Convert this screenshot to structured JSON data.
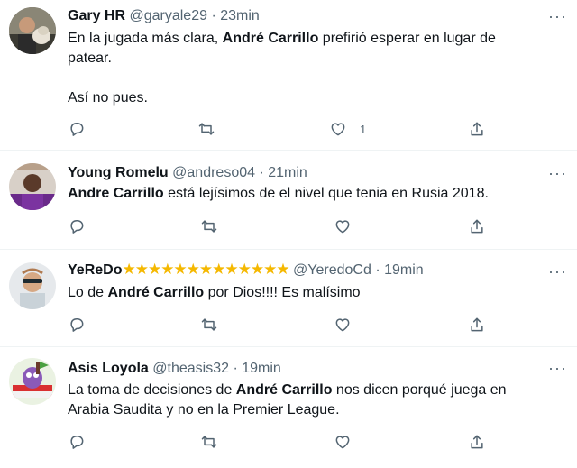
{
  "tweets": [
    {
      "name": "Gary HR",
      "handle": "@garyale29",
      "sep": "·",
      "time": "23min",
      "stars": "",
      "lines": [
        {
          "pre": "En la jugada más clara, ",
          "bold": "André Carrillo",
          "post": " prefirió esperar en lugar de"
        },
        {
          "pre": "patear.",
          "bold": "",
          "post": ""
        },
        {
          "pre": "",
          "bold": "",
          "post": ""
        },
        {
          "pre": "Así no pues.",
          "bold": "",
          "post": ""
        }
      ],
      "like_count": "1",
      "avatar": "photo-man-with-dog"
    },
    {
      "name": "Young Romelu",
      "handle": "@andreso04",
      "sep": "·",
      "time": "21min",
      "stars": "",
      "lines": [
        {
          "pre": "",
          "bold": "Andre Carrillo",
          "post": " está lejísimos de el nivel que tenia en Rusia 2018."
        }
      ],
      "like_count": "",
      "avatar": "photo-player-purple-shirt"
    },
    {
      "name": "YeReDo",
      "handle": "@YeredoCd",
      "sep": "·",
      "time": "19min",
      "stars": "★★★★★★★★★★★★★",
      "lines": [
        {
          "pre": "Lo de ",
          "bold": "André Carrillo",
          "post": " por Dios!!!! Es malísimo"
        }
      ],
      "like_count": "",
      "avatar": "photo-man-sunglasses"
    },
    {
      "name": "Asis Loyola",
      "handle": "@theasis32",
      "sep": "·",
      "time": "19min",
      "stars": "",
      "lines": [
        {
          "pre": "La toma de decisiones de ",
          "bold": "André Carrillo",
          "post": " nos dicen porqué juega en"
        },
        {
          "pre": "Arabia Saudita y no en la Premier League.",
          "bold": "",
          "post": ""
        }
      ],
      "like_count": "",
      "avatar": "cartoon-character-flag"
    }
  ],
  "more_label": "···",
  "colors": {
    "text": "#0f1419",
    "secondary": "#536471",
    "star": "#f5b800",
    "divider": "#eff3f4"
  }
}
